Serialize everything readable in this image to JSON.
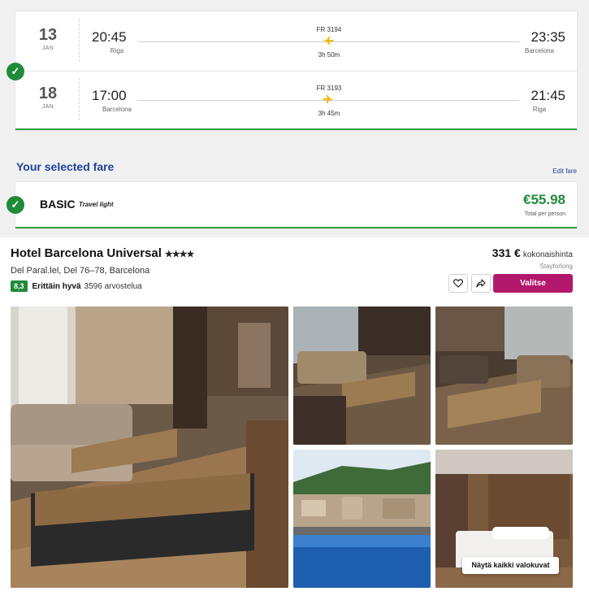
{
  "flights": [
    {
      "day": "13",
      "month": "JAN",
      "dep_time": "20:45",
      "dep_city": "Riga",
      "flight_no": "FR 3194",
      "duration": "3h 50m",
      "arr_time": "23:35",
      "arr_city": "Barcelona"
    },
    {
      "day": "18",
      "month": "JAN",
      "dep_time": "17:00",
      "dep_city": "Barcelona",
      "flight_no": "FR 3193",
      "duration": "3h 45m",
      "arr_time": "21:45",
      "arr_city": "Riga"
    }
  ],
  "fare": {
    "heading": "Your selected fare",
    "edit_label": "Edit fare",
    "name": "BASIC",
    "subtitle": "Travel light",
    "price": "€55.98",
    "per_person": "Total per person"
  },
  "hotel": {
    "name": "Hotel Barcelona Universal",
    "stars": "★★★★",
    "address": "Del Paral.lel, Del 76–78, Barcelona",
    "rating_score": "8,3",
    "rating_word": "Erittäin hyvä",
    "review_count": "3596 arvostelua",
    "price": "331 €",
    "price_unit": "kokonaishinta",
    "provider": "Stayforlong",
    "select_label": "Valitse",
    "all_photos_label": "Näytä kaikki valokuvat"
  },
  "icons": {
    "check": "check-icon",
    "plane": "plane-icon",
    "heart": "heart-icon",
    "share": "share-icon"
  },
  "colors": {
    "accent_green": "#1f8a3a",
    "fare_blue": "#1f3f9a",
    "select_magenta": "#b2186b",
    "plane_yellow": "#f2b705"
  }
}
